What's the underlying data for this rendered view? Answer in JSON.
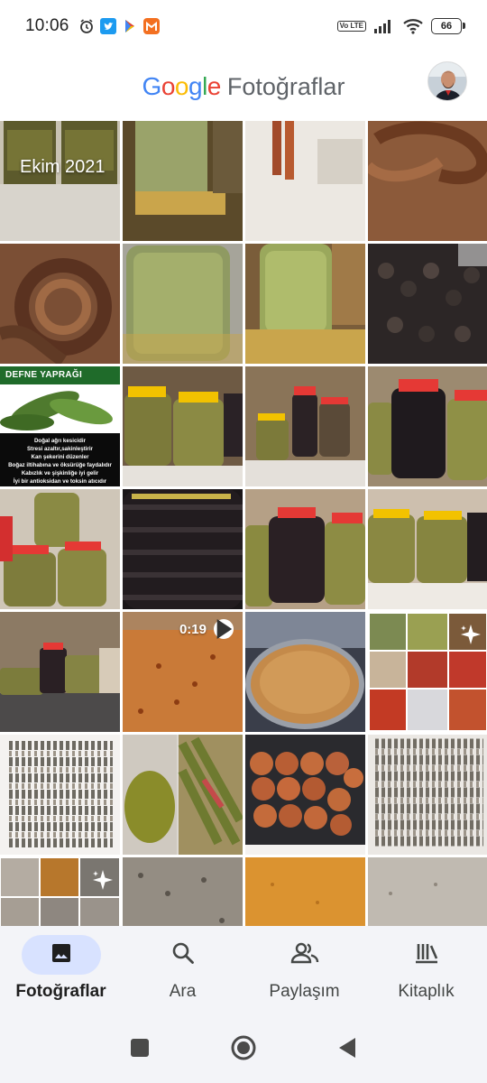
{
  "status_bar": {
    "time": "10:06",
    "battery": "66",
    "network": "Vo LTE"
  },
  "header": {
    "brand_letters": [
      "G",
      "o",
      "o",
      "g",
      "l",
      "e"
    ],
    "brand_colors": [
      "#4285F4",
      "#EA4335",
      "#FBBC05",
      "#4285F4",
      "#34A853",
      "#EA4335"
    ],
    "product": "Fotoğraflar"
  },
  "gallery": {
    "date_label": "Ekim 2021",
    "video_duration": "0:19",
    "poster": {
      "title": "DEFNE YAPRAĞI",
      "lines": [
        "Doğal ağrı kesicidir",
        "Stresi azaltır,sakinleştirir",
        "Kan şekerini düzenler",
        "Boğaz iltihabına ve öksürüğe faydalıdır",
        "Kabızlık ve şişkinliğe iyi gelir",
        "İyi bir antioksidan ve toksin atıcıdır"
      ]
    }
  },
  "bottom_nav": {
    "items": [
      {
        "label": "Fotoğraflar",
        "icon": "photo-icon",
        "active": true
      },
      {
        "label": "Ara",
        "icon": "search-icon",
        "active": false
      },
      {
        "label": "Paylaşım",
        "icon": "people-icon",
        "active": false
      },
      {
        "label": "Kitaplık",
        "icon": "library-icon",
        "active": false
      }
    ]
  },
  "colors": {
    "accent_pill": "#d8e2ff",
    "nav_background": "#f3f4f8"
  }
}
